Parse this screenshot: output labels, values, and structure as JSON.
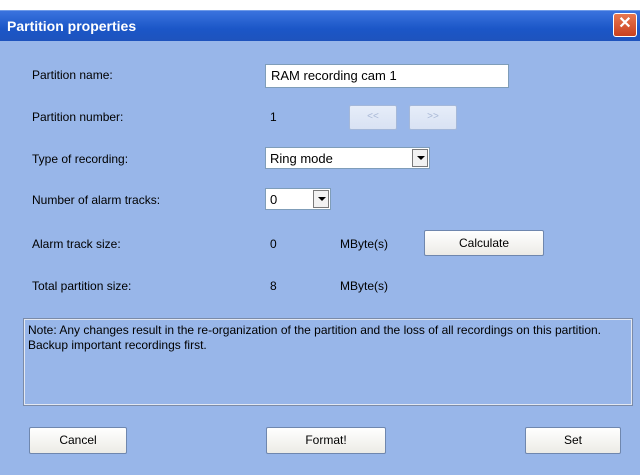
{
  "window": {
    "title": "Partition properties",
    "close_glyph": "✕"
  },
  "form": {
    "partition_name_label": "Partition name:",
    "partition_name_value": "RAM recording cam 1",
    "partition_number_label": "Partition number:",
    "partition_number_value": "1",
    "prev_label": "<<",
    "next_label": ">>",
    "recording_type_label": "Type of recording:",
    "recording_type_value": "Ring mode",
    "alarm_tracks_label": "Number of alarm tracks:",
    "alarm_tracks_value": "0",
    "alarm_size_label": "Alarm track size:",
    "alarm_size_value": "0",
    "alarm_size_unit": "MByte(s)",
    "calculate_label": "Calculate",
    "total_size_label": "Total partition size:",
    "total_size_value": "8",
    "total_size_unit": "MByte(s)"
  },
  "note": "Note: Any changes result in the re-organization of the partition and the loss of all recordings on this partition. Backup important recordings first.",
  "buttons": {
    "cancel": "Cancel",
    "format": "Format!",
    "set": "Set"
  },
  "colors": {
    "background": "#98b6e9",
    "titlebar": "#1b56c7"
  }
}
